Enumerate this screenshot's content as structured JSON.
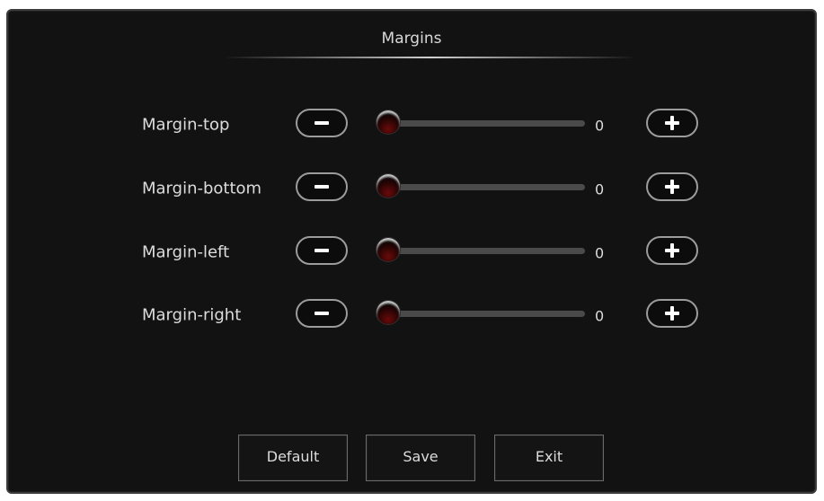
{
  "dialog": {
    "title": "Margins"
  },
  "rows": [
    {
      "label": "Margin-top",
      "value": "0",
      "level": 0
    },
    {
      "label": "Margin-bottom",
      "value": "0",
      "level": 0
    },
    {
      "label": "Margin-left",
      "value": "0",
      "level": 0
    },
    {
      "label": "Margin-right",
      "value": "0",
      "level": 0
    }
  ],
  "buttons": {
    "default_label": "Default",
    "save_label": "Save",
    "exit_label": "Exit"
  },
  "icons": {
    "decrease": "minus-icon",
    "increase": "plus-icon"
  },
  "colors": {
    "background": "#121212",
    "text": "#dcdcdc",
    "track": "#4a4a4a",
    "thumb": "#6a0a0a"
  }
}
